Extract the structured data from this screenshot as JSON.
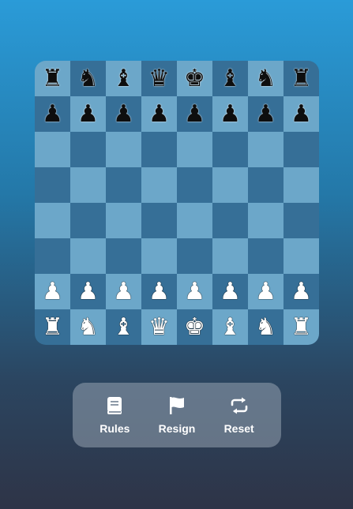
{
  "board": {
    "ranks": [
      [
        {
          "glyph": "♜",
          "color": "black"
        },
        {
          "glyph": "♞",
          "color": "black"
        },
        {
          "glyph": "♝",
          "color": "black"
        },
        {
          "glyph": "♛",
          "color": "black"
        },
        {
          "glyph": "♚",
          "color": "black"
        },
        {
          "glyph": "♝",
          "color": "black"
        },
        {
          "glyph": "♞",
          "color": "black"
        },
        {
          "glyph": "♜",
          "color": "black"
        }
      ],
      [
        {
          "glyph": "♟",
          "color": "black"
        },
        {
          "glyph": "♟",
          "color": "black"
        },
        {
          "glyph": "♟",
          "color": "black"
        },
        {
          "glyph": "♟",
          "color": "black"
        },
        {
          "glyph": "♟",
          "color": "black"
        },
        {
          "glyph": "♟",
          "color": "black"
        },
        {
          "glyph": "♟",
          "color": "black"
        },
        {
          "glyph": "♟",
          "color": "black"
        }
      ],
      [
        null,
        null,
        null,
        null,
        null,
        null,
        null,
        null
      ],
      [
        null,
        null,
        null,
        null,
        null,
        null,
        null,
        null
      ],
      [
        null,
        null,
        null,
        null,
        null,
        null,
        null,
        null
      ],
      [
        null,
        null,
        null,
        null,
        null,
        null,
        null,
        null
      ],
      [
        {
          "glyph": "♟",
          "color": "white"
        },
        {
          "glyph": "♟",
          "color": "white"
        },
        {
          "glyph": "♟",
          "color": "white"
        },
        {
          "glyph": "♟",
          "color": "white"
        },
        {
          "glyph": "♟",
          "color": "white"
        },
        {
          "glyph": "♟",
          "color": "white"
        },
        {
          "glyph": "♟",
          "color": "white"
        },
        {
          "glyph": "♟",
          "color": "white"
        }
      ],
      [
        {
          "glyph": "♜",
          "color": "white"
        },
        {
          "glyph": "♞",
          "color": "white"
        },
        {
          "glyph": "♝",
          "color": "white"
        },
        {
          "glyph": "♛",
          "color": "white"
        },
        {
          "glyph": "♚",
          "color": "white"
        },
        {
          "glyph": "♝",
          "color": "white"
        },
        {
          "glyph": "♞",
          "color": "white"
        },
        {
          "glyph": "♜",
          "color": "white"
        }
      ]
    ],
    "light_color": "#6ca7c9",
    "dark_color": "#366f97"
  },
  "controls": {
    "rules": {
      "label": "Rules",
      "icon": "book-icon"
    },
    "resign": {
      "label": "Resign",
      "icon": "flag-icon"
    },
    "reset": {
      "label": "Reset",
      "icon": "repeat-icon"
    }
  }
}
